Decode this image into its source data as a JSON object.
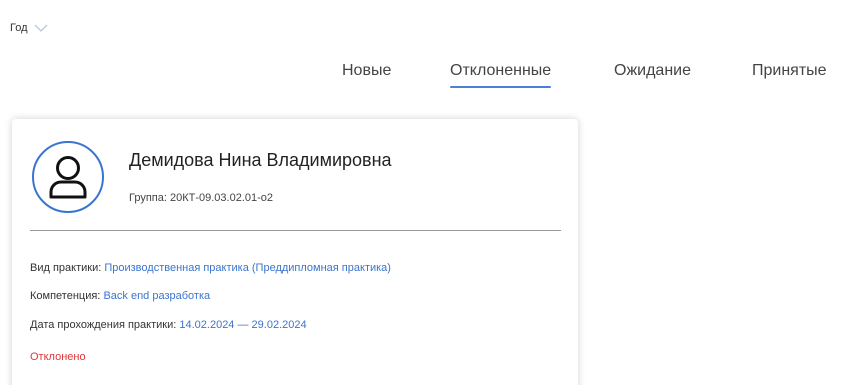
{
  "filter": {
    "year_label": "Год",
    "icon": "chevron-down-icon"
  },
  "tabs": [
    {
      "label": "Новые",
      "active": false
    },
    {
      "label": "Отклоненные",
      "active": true
    },
    {
      "label": "Ожидание",
      "active": false
    },
    {
      "label": "Принятые",
      "active": false
    }
  ],
  "card": {
    "avatar_icon": "user-icon",
    "name": "Демидова Нина Владимировна",
    "group": "Группа: 20КТ-09.03.02.01-о2",
    "practice_type_label": "Вид практики:",
    "practice_type_value": "Производственная практика (Преддипломная практика)",
    "competence_label": "Компетенция:",
    "competence_value": "Back end разработка",
    "dates_label": "Дата прохождения практики:",
    "dates_value": "14.02.2024 — 29.02.2024",
    "status": "Отклонено"
  },
  "colors": {
    "accent": "#3b74cf",
    "tab_underline": "#4d7fd8",
    "status_rejected": "#e0343a"
  }
}
